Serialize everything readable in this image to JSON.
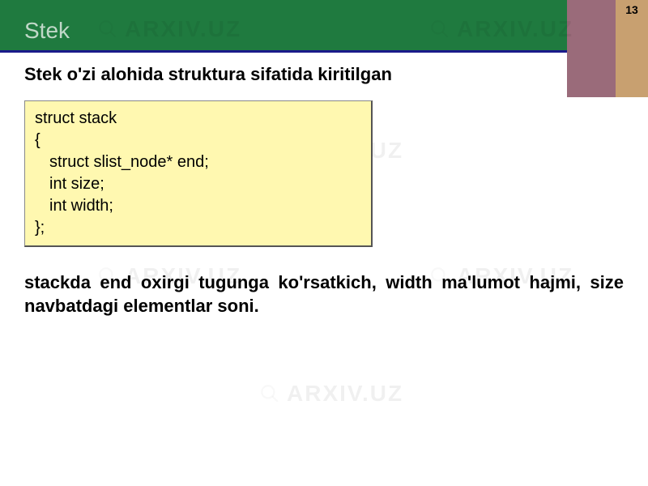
{
  "page_number": "13",
  "header": {
    "title": "Stek"
  },
  "subtitle": "Stek o'zi alohida struktura sifatida kiritilgan",
  "code": {
    "l1": "struct stack",
    "l2": "{",
    "l3": "struct slist_node* end;",
    "l4": "int size;",
    "l5": "int width;",
    "l6": "};"
  },
  "explanation": "stackda end oxirgi tugunga ko'rsatkich, width ma'lumot hajmi, size navbatdagi elementlar soni.",
  "watermark_text": "ARXIV.UZ"
}
